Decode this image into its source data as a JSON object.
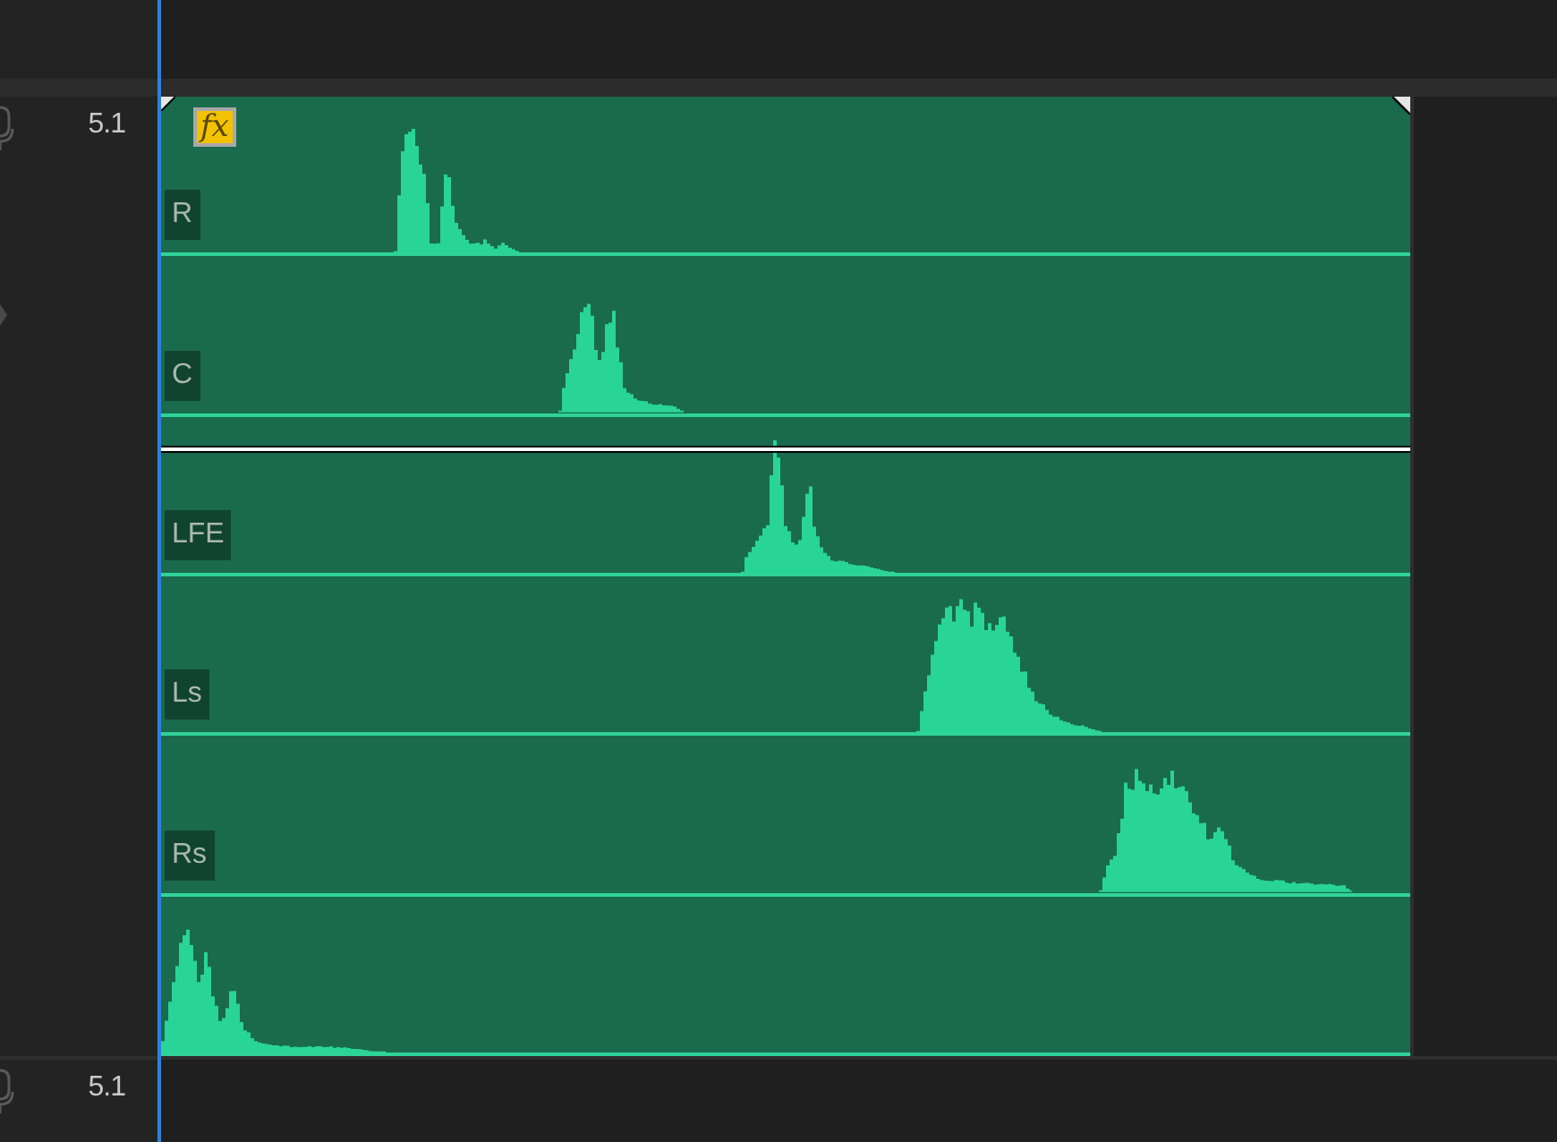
{
  "tracks": [
    {
      "format": "5.1",
      "clip": {
        "effect_badge": "fx",
        "channel_labels": [
          "R",
          "C",
          "LFE",
          "Ls",
          "Rs"
        ]
      }
    },
    {
      "format": "5.1"
    }
  ]
}
